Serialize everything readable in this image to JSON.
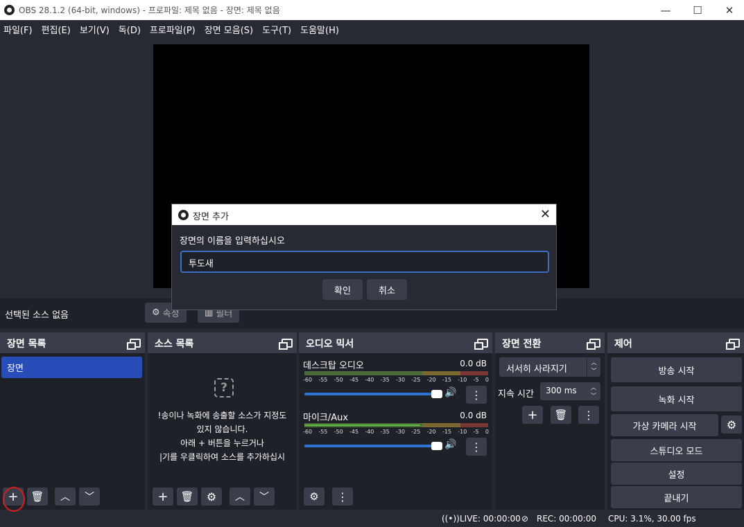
{
  "window": {
    "title": "OBS 28.1.2 (64-bit, windows) - 프로파일: 제목 없음 - 장면: 제목 없음"
  },
  "menu": [
    {
      "label": "파일(F)"
    },
    {
      "label": "편집(E)"
    },
    {
      "label": "보기(V)"
    },
    {
      "label": "독(D)"
    },
    {
      "label": "프로파일(P)"
    },
    {
      "label": "장면 모음(S)"
    },
    {
      "label": "도구(T)"
    },
    {
      "label": "도움말(H)"
    }
  ],
  "context": {
    "no_selection": "선택된 소스 없음",
    "properties": "속성",
    "filters": "필터"
  },
  "scenes": {
    "title": "장면 목록",
    "items": [
      {
        "label": "장면"
      }
    ]
  },
  "sources": {
    "title": "소스 목록",
    "empty_lines": [
      "!송이나 녹화에 송출할 소스가 지정도",
      "있지 않습니다.",
      "아래 + 버튼을 누르거나",
      "|기를 우클릭하여 소스를 추가하십시"
    ]
  },
  "mixer": {
    "title": "오디오 믹서",
    "ticks": [
      "-60",
      "-55",
      "-50",
      "-45",
      "-40",
      "-35",
      "-30",
      "-25",
      "-20",
      "-15",
      "-10",
      "-5",
      "0"
    ],
    "tracks": [
      {
        "name": "데스크탑 오디오",
        "db": "0.0 dB",
        "level": 0.0
      },
      {
        "name": "마이크/Aux",
        "db": "0.0 dB",
        "level": 0.63
      }
    ]
  },
  "transitions": {
    "title": "장면 전환",
    "selected": "서서히 사라지기",
    "duration_label": "지속 시간",
    "duration_value": "300 ms"
  },
  "controls": {
    "title": "제어",
    "buttons": [
      "방송 시작",
      "녹화 시작",
      "가상 카메라 시작",
      "스튜디오 모드",
      "설정",
      "끝내기"
    ]
  },
  "status": {
    "live": "LIVE: 00:00:00",
    "rec": "REC: 00:00:00",
    "cpu": "CPU: 3.1%, 30.00 fps"
  },
  "dialog": {
    "title": "장면 추가",
    "prompt": "장면의 이름을 입력하십시오",
    "input_value": "투도새",
    "ok": "확인",
    "cancel": "취소"
  }
}
